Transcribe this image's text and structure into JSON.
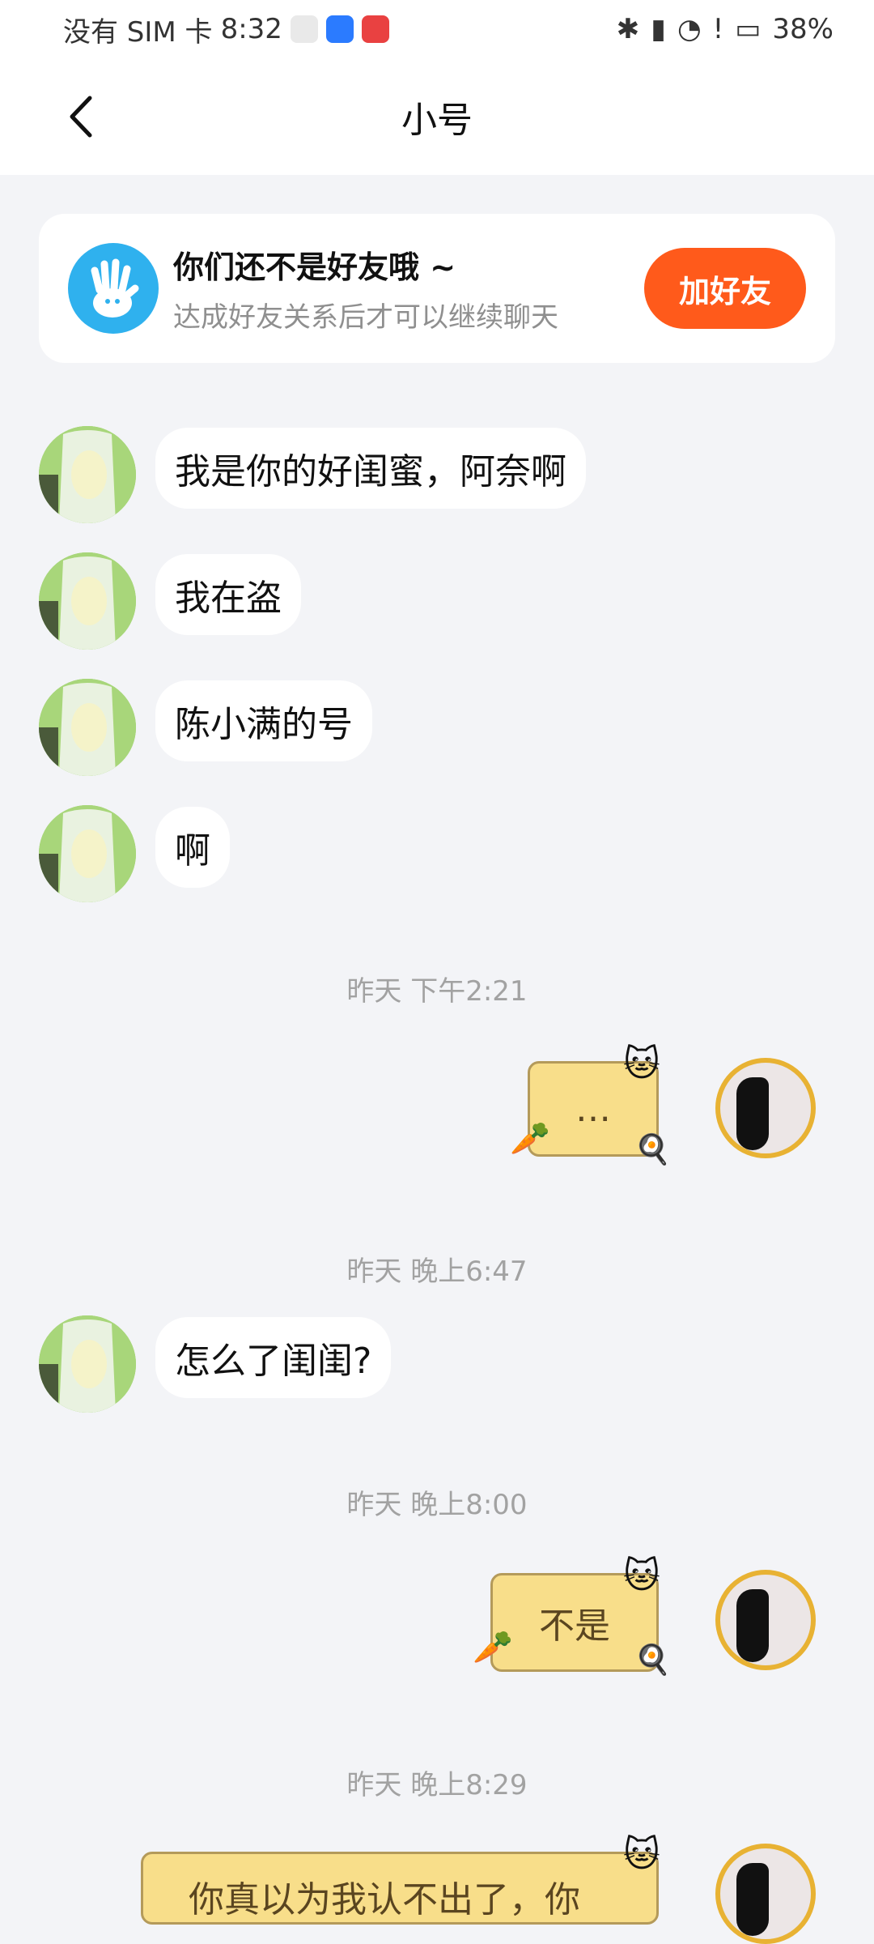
{
  "status_bar": {
    "carrier": "没有 SIM 卡",
    "time": "8:32",
    "battery": "38%"
  },
  "header": {
    "title": "小号"
  },
  "friend_notice": {
    "title": "你们还不是好友哦 ~",
    "subtitle": "达成好友关系后才可以继续聊天",
    "button": "加好友"
  },
  "messages": [
    {
      "text": "我是你的好闺蜜，阿奈啊"
    },
    {
      "text": "我在盗"
    },
    {
      "text": "陈小满的号"
    },
    {
      "text": "啊"
    }
  ],
  "timestamps": [
    "昨天 下午2:21",
    "昨天 晚上6:47",
    "昨天 晚上8:00",
    "昨天 晚上8:29"
  ],
  "sent_messages": [
    {
      "text": "…"
    },
    {
      "text": "不是"
    },
    {
      "text": "你真以为我认不出了，你"
    }
  ],
  "received_later": {
    "text": "怎么了闺闺?"
  },
  "colors": {
    "accent": "#ff5a1b",
    "notice_icon": "#2fb1ee",
    "sticker_bg": "#f8de8a"
  }
}
